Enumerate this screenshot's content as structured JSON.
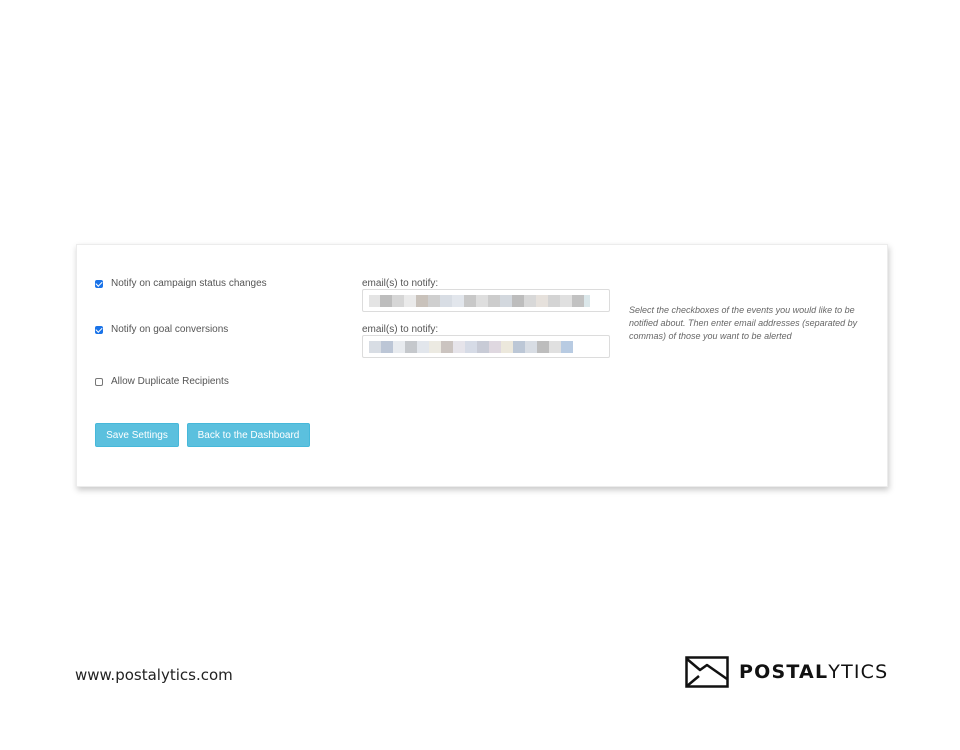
{
  "settings": {
    "campaign_status": {
      "label": "Notify on campaign status changes",
      "checked": true,
      "email_label": "email(s) to notify:"
    },
    "goal_conversions": {
      "label": "Notify on goal conversions",
      "checked": true,
      "email_label": "email(s) to notify:"
    },
    "duplicate_recipients": {
      "label": "Allow Duplicate Recipients",
      "checked": false
    },
    "help_text": "Select the checkboxes of the events you would like to be notified about. Then enter email addresses (separated by commas) of those you want to be alerted"
  },
  "buttons": {
    "save_label": "Save Settings",
    "back_label": "Back to the Dashboard"
  },
  "footer": {
    "url": "www.postalytics.com",
    "logo_bold": "POSTAL",
    "logo_light": "YTICS"
  },
  "colors": {
    "button_bg": "#5bc0de",
    "checkbox_checked": "#1a73e8",
    "panel_bg": "#ffffff"
  },
  "icons": {
    "checkbox_checked": "checkbox-checked-icon",
    "checkbox_unchecked": "checkbox-unchecked-icon",
    "logo": "envelope-icon"
  }
}
